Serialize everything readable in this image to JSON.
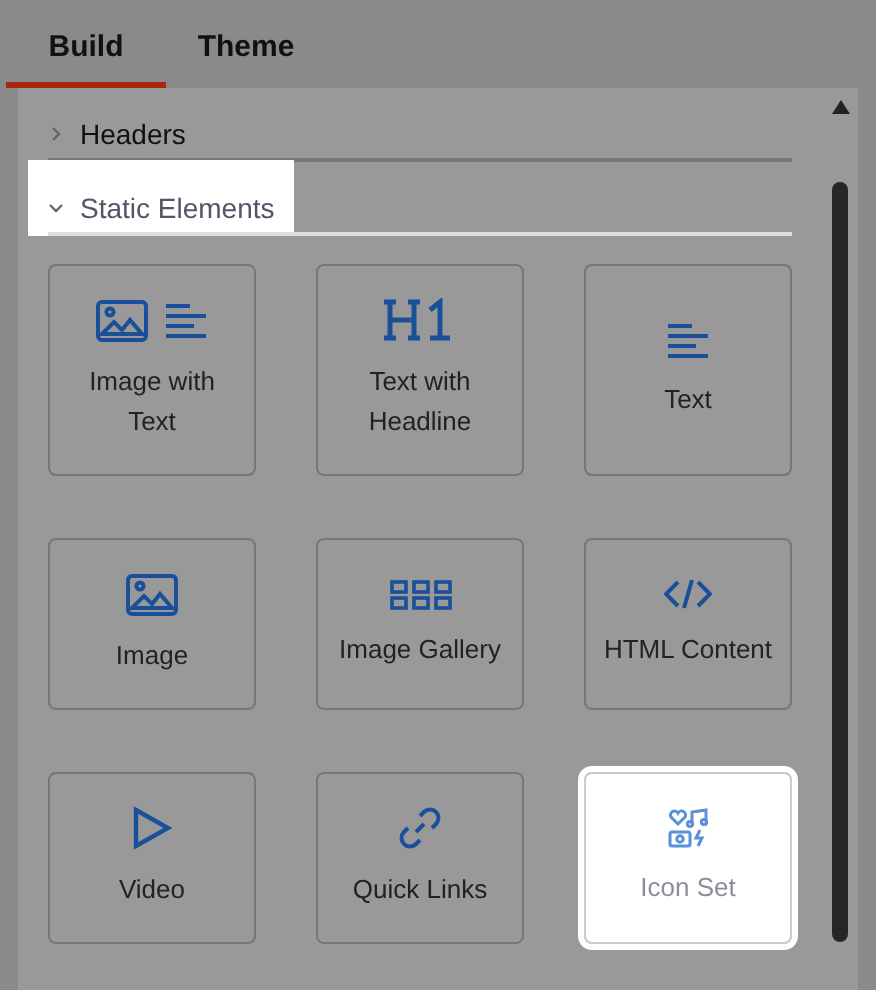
{
  "tabs": [
    {
      "label": "Build",
      "selected": true
    },
    {
      "label": "Theme",
      "selected": false
    }
  ],
  "sections": [
    {
      "title": "Headers",
      "expanded": false,
      "highlighted": false
    },
    {
      "title": "Static Elements",
      "expanded": true,
      "highlighted": true,
      "tiles": [
        {
          "kind": "image-text",
          "label": "Image with Text",
          "highlighted": false
        },
        {
          "kind": "headline",
          "label": "Text with Headline",
          "highlighted": false
        },
        {
          "kind": "text",
          "label": "Text",
          "highlighted": false
        },
        {
          "kind": "image",
          "label": "Image",
          "highlighted": false
        },
        {
          "kind": "gallery",
          "label": "Image Gallery",
          "highlighted": false
        },
        {
          "kind": "html",
          "label": "HTML Content",
          "highlighted": false
        },
        {
          "kind": "video",
          "label": "Video",
          "highlighted": false
        },
        {
          "kind": "link",
          "label": "Quick Links",
          "highlighted": false
        },
        {
          "kind": "icon-set",
          "label": "Icon Set",
          "highlighted": true
        }
      ]
    }
  ]
}
